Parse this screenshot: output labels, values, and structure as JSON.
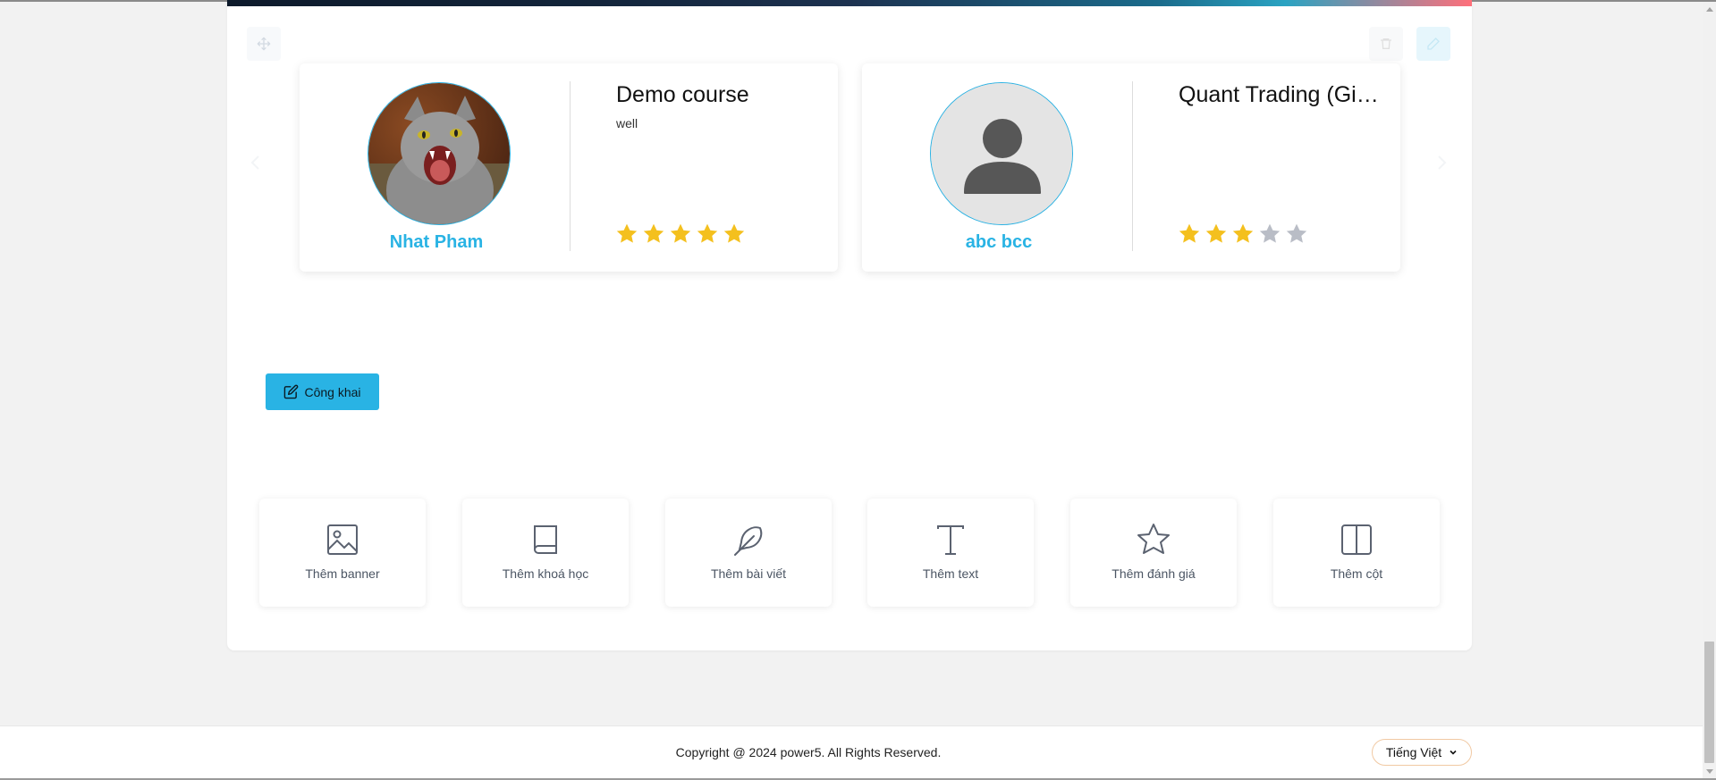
{
  "reviews": [
    {
      "reviewer_name": "Nhat Pham",
      "avatar": "cat-photo",
      "course_title": "Demo course",
      "review_text": "well",
      "rating": 5,
      "max_rating": 5
    },
    {
      "reviewer_name": "abc bcc",
      "avatar": "default-user-icon",
      "course_title": "Quant Trading (Gia...",
      "review_text": "",
      "rating": 3,
      "max_rating": 5
    }
  ],
  "publish_button": {
    "label": "Công khai",
    "icon": "edit-icon"
  },
  "add_blocks": [
    {
      "label": "Thêm banner",
      "icon": "image-icon"
    },
    {
      "label": "Thêm khoá học",
      "icon": "book-icon"
    },
    {
      "label": "Thêm bài viết",
      "icon": "feather-icon"
    },
    {
      "label": "Thêm text",
      "icon": "text-icon"
    },
    {
      "label": "Thêm đánh giá",
      "icon": "star-icon"
    },
    {
      "label": "Thêm cột",
      "icon": "columns-icon"
    }
  ],
  "footer": {
    "copyright": "Copyright @ 2024 power5. All Rights Reserved.",
    "language": "Tiếng Việt"
  },
  "colors": {
    "accent": "#29b3e4",
    "star_filled": "#f4c01e",
    "star_empty": "#b9bdc6"
  }
}
